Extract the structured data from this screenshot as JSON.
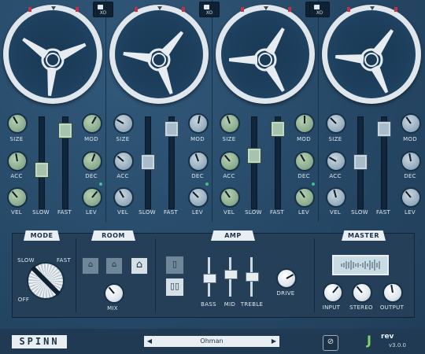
{
  "channels": [
    {
      "xo": "XO",
      "knobs": {
        "size": "SIZE",
        "acc": "ACC",
        "vel": "VEL",
        "mod": "MOD",
        "dec": "DEC",
        "lev": "LEV"
      },
      "faders": {
        "slow": "SLOW",
        "fast": "FAST"
      }
    },
    {
      "xo": "XO",
      "knobs": {
        "size": "SIZE",
        "acc": "ACC",
        "vel": "VEL",
        "mod": "MOD",
        "dec": "DEC",
        "lev": "LEV"
      },
      "faders": {
        "slow": "SLOW",
        "fast": "FAST"
      }
    },
    {
      "xo": "XO",
      "knobs": {
        "size": "SIZE",
        "acc": "ACC",
        "vel": "VEL",
        "mod": "MOD",
        "dec": "DEC",
        "lev": "LEV"
      },
      "faders": {
        "slow": "SLOW",
        "fast": "FAST"
      }
    },
    {
      "xo": "XO",
      "knobs": {
        "size": "SIZE",
        "acc": "ACC",
        "vel": "VEL",
        "mod": "MOD",
        "dec": "DEC",
        "lev": "LEV"
      },
      "faders": {
        "slow": "SLOW",
        "fast": "FAST"
      }
    }
  ],
  "mode": {
    "title": "MODE",
    "slow": "SLOW",
    "fast": "FAST",
    "off": "OFF"
  },
  "room": {
    "title": "ROOM",
    "mix": "MIX",
    "icon": "house-icon"
  },
  "amp": {
    "title": "AMP",
    "bass": "BASS",
    "mid": "MID",
    "treble": "TREBLE",
    "drive": "DRIVE"
  },
  "master": {
    "title": "MASTER",
    "input": "INPUT",
    "stereo": "STEREO",
    "output": "OUTPUT"
  },
  "footer": {
    "logo": "SPINN",
    "preset": "Ohman",
    "prev": "◀",
    "next": "▶",
    "brand_top": "rev",
    "version": "v3.0.0"
  },
  "colors": {
    "accent_green": "#8fae92",
    "panel": "#274a66",
    "led": "#3fc38a",
    "reel_mark": "#c0314a"
  }
}
